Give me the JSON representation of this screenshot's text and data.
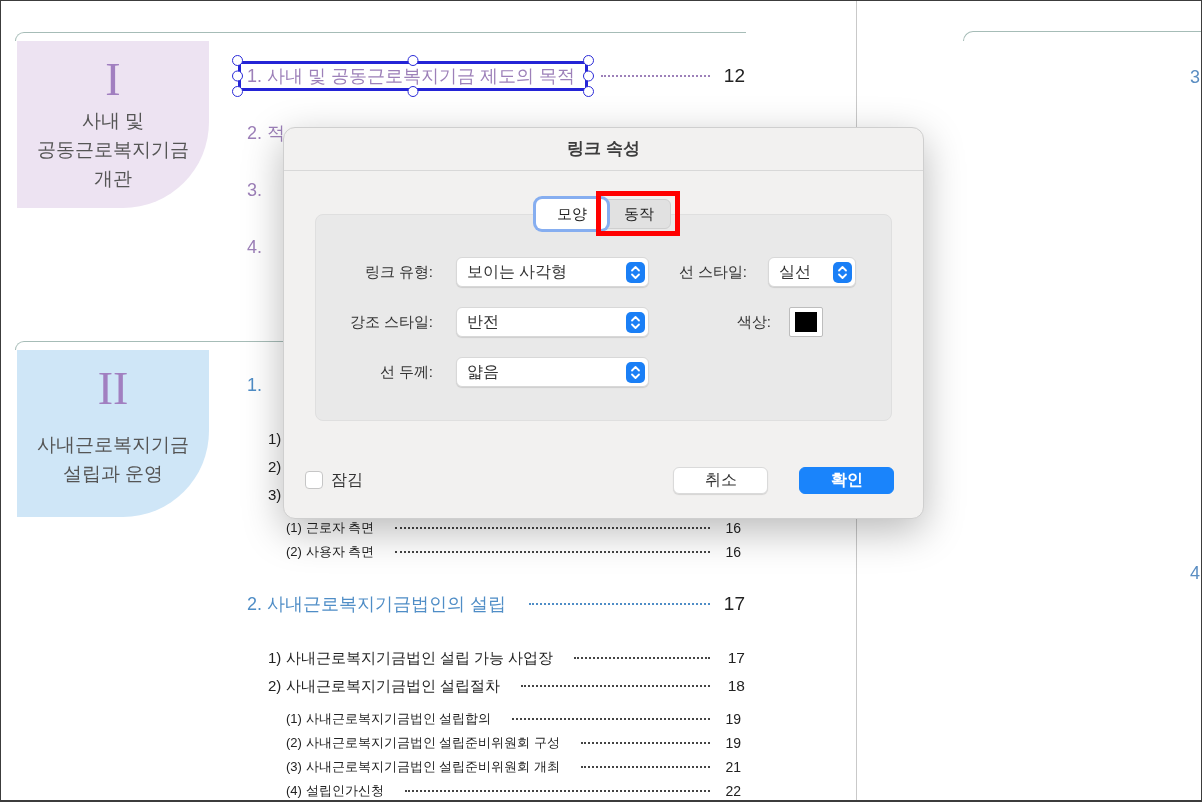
{
  "left_page": {
    "chapters": [
      {
        "numeral": "I",
        "title_lines": [
          "사내 및",
          "공동근로복지기금",
          "개관"
        ],
        "color": "#ede3f2",
        "entries": [
          {
            "kind": "heading",
            "label": "1. 사내 및 공동근로복지기금 제도의 목적",
            "page": "12",
            "selected": true
          },
          {
            "kind": "heading",
            "label": "2. 적",
            "selected": false
          },
          {
            "kind": "heading",
            "label": "3.",
            "selected": false
          },
          {
            "kind": "heading",
            "label": "4.",
            "selected": false
          }
        ]
      },
      {
        "numeral": "II",
        "title_lines": [
          "사내근로복지기금",
          "설립과 운영"
        ],
        "color": "#cfe6f7",
        "entries": [
          {
            "kind": "heading",
            "label": "1.",
            "selected": false
          },
          {
            "kind": "item",
            "label": "1)",
            "selected": false
          },
          {
            "kind": "item",
            "label": "2)",
            "selected": false
          },
          {
            "kind": "item",
            "label": "3)",
            "selected": false
          },
          {
            "kind": "subitem",
            "label": "(1) 근로자 측면",
            "page": "16",
            "selected": false
          },
          {
            "kind": "subitem",
            "label": "(2) 사용자 측면",
            "page": "16",
            "selected": false
          },
          {
            "kind": "heading",
            "label": "2. 사내근로복지기금법인의 설립",
            "page": "17",
            "selected": false
          },
          {
            "kind": "item",
            "label": "1) 사내근로복지기금법인 설립 가능 사업장",
            "page": "17",
            "selected": false
          },
          {
            "kind": "item",
            "label": "2) 사내근로복지기금법인 설립절차",
            "page": "18",
            "selected": false
          },
          {
            "kind": "subitem",
            "label": "(1) 사내근로복지기금법인 설립합의",
            "page": "19",
            "selected": false
          },
          {
            "kind": "subitem",
            "label": "(2) 사내근로복지기금법인 설립준비위원회 구성",
            "page": "19",
            "selected": false
          },
          {
            "kind": "subitem",
            "label": "(3) 사내근로복지기금법인 설립준비위원회 개최",
            "page": "21",
            "selected": false
          },
          {
            "kind": "subitem",
            "label": "(4) 설립인가신청",
            "page": "22",
            "selected": false
          }
        ]
      }
    ]
  },
  "right_page": {
    "entries": [
      {
        "label": "3"
      },
      {
        "label": "4"
      }
    ]
  },
  "dialog": {
    "title": "링크 속성",
    "tabs": [
      {
        "label": "모양",
        "selected": true,
        "highlighted": false
      },
      {
        "label": "동작",
        "selected": false,
        "highlighted": true
      }
    ],
    "fields": [
      {
        "kind": "dropdown",
        "label": "링크 유형:",
        "value": "보이는 사각형"
      },
      {
        "kind": "dropdown",
        "label": "선 스타일:",
        "value": "실선"
      },
      {
        "kind": "dropdown",
        "label": "강조 스타일:",
        "value": "반전"
      },
      {
        "kind": "color",
        "label": "색상:",
        "color": "#000000"
      },
      {
        "kind": "dropdown",
        "label": "선 두께:",
        "value": "얇음"
      }
    ],
    "lock": {
      "label": "잠김",
      "checked": false
    },
    "buttons": [
      {
        "kind": "secondary",
        "label": "취소"
      },
      {
        "kind": "primary",
        "label": "확인"
      }
    ]
  }
}
